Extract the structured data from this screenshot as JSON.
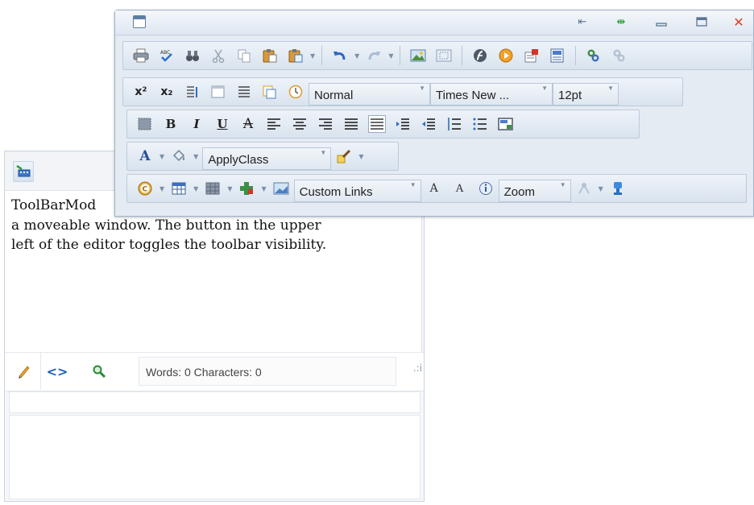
{
  "toolbar_window": {
    "title_icon": "window-icon",
    "controls": [
      "dock-icon",
      "move-icon",
      "minimize-icon",
      "maximize-icon",
      "close-icon"
    ],
    "close_glyph": "✕"
  },
  "dropdowns": {
    "paragraph_style": "Normal",
    "font_name": "Times New ...",
    "font_size": "12pt",
    "css_class": "ApplyClass",
    "custom_links": "Custom Links",
    "zoom": "Zoom"
  },
  "format_buttons": {
    "superscript": "x²",
    "subscript": "x₂",
    "bold": "B",
    "italic": "I",
    "underline": "U",
    "strikethrough": "A",
    "forecolor": "A",
    "grow_font": "A",
    "shrink_font": "A"
  },
  "editor": {
    "content_lines": [
      "ToolBarMod",
      "a  moveable window. The button in the upper",
      "left of the editor toggles the toolbar visibility."
    ],
    "mode_tabs": [
      "design-icon",
      "html-icon",
      "preview-icon"
    ],
    "html_tab_glyph": "<>",
    "word_count_text": "Words: 0 Characters: 0"
  },
  "colors": {
    "toolbar_bg": "#e5ebf2",
    "toolbar_border": "#9fb3cc",
    "close_red": "#e2401c",
    "accent_blue": "#1c5fb8"
  }
}
